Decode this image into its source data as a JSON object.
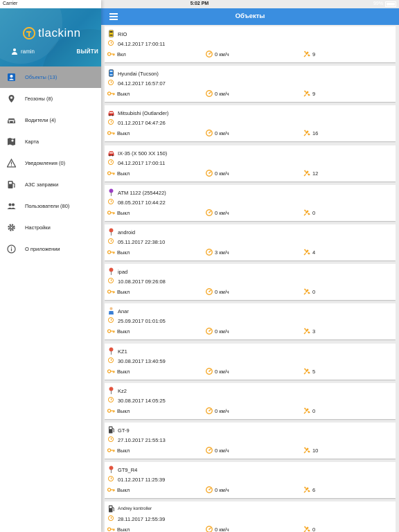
{
  "status_bar": {
    "carrier": "Carrier",
    "time": "5:02 PM",
    "battery": "99%"
  },
  "sidebar": {
    "logo": "tlackinn",
    "user": "ramin",
    "logout": "ВЫЙТИ",
    "items": [
      {
        "label": "Объекты (13)",
        "icon": "objects-icon"
      },
      {
        "label": "Геозоны (8)",
        "icon": "geofence-pin-icon"
      },
      {
        "label": "Водители (4)",
        "icon": "car-icon"
      },
      {
        "label": "Карта",
        "icon": "map-icon"
      },
      {
        "label": "Уведомления (0)",
        "icon": "warning-icon"
      },
      {
        "label": "АЗС заправки",
        "icon": "fuel-icon"
      },
      {
        "label": "Пользователи (80)",
        "icon": "users-icon"
      },
      {
        "label": "Настройки",
        "icon": "gear-icon"
      },
      {
        "label": "О приложении",
        "icon": "info-icon"
      }
    ]
  },
  "topbar": {
    "title": "Объекты"
  },
  "objects": [
    {
      "name": "RIO",
      "date": "04.12.2017 17:00:11",
      "ignition": "Вкл",
      "speed": "0 км/ч",
      "satellites": "9",
      "icon": "yellow-car-icon"
    },
    {
      "name": "Hyundai  (Tucson)",
      "date": "04.12.2017 16:57:07",
      "ignition": "Выкл",
      "speed": "0 км/ч",
      "satellites": "9",
      "icon": "blue-car-icon"
    },
    {
      "name": "Mitsubishi  (Outlander)",
      "date": "01.12.2017 04:47:26",
      "ignition": "Выкл",
      "speed": "0 км/ч",
      "satellites": "16",
      "icon": "red-car-icon"
    },
    {
      "name": "IX-35  (X 500 XX 150)",
      "date": "04.12.2017 17:00:11",
      "ignition": "Выкл",
      "speed": "0 км/ч",
      "satellites": "12",
      "icon": "red-car-icon"
    },
    {
      "name": "ATM 1122  (2554422)",
      "date": "08.05.2017 10:44:22",
      "ignition": "Выкл",
      "speed": "0 км/ч",
      "satellites": "0",
      "icon": "purple-pin-icon"
    },
    {
      "name": "android",
      "date": "05.11.2017 22:38:10",
      "ignition": "Выкл",
      "speed": "3 км/ч",
      "satellites": "4",
      "icon": "red-pin-icon"
    },
    {
      "name": "ipad",
      "date": "10.08.2017 09:26:08",
      "ignition": "Выкл",
      "speed": "0 км/ч",
      "satellites": "0",
      "icon": "red-pin-icon"
    },
    {
      "name": "Anar",
      "date": "25.09.2017 01:01:05",
      "ignition": "Выкл",
      "speed": "0 км/ч",
      "satellites": "3",
      "icon": "person-icon"
    },
    {
      "name": "KZ1",
      "date": "30.08.2017 13:40:59",
      "ignition": "Выкл",
      "speed": "0 км/ч",
      "satellites": "5",
      "icon": "red-pin-icon"
    },
    {
      "name": "Kz2",
      "date": "30.08.2017 14:05:25",
      "ignition": "Выкл",
      "speed": "0 км/ч",
      "satellites": "0",
      "icon": "red-pin-icon"
    },
    {
      "name": "GT-9",
      "date": "27.10.2017 21:55:13",
      "ignition": "Выкл",
      "speed": "0 км/ч",
      "satellites": "10",
      "icon": "fuel-pump-icon"
    },
    {
      "name": "GT9_R4",
      "date": "01.12.2017 11:25:39",
      "ignition": "Выкл",
      "speed": "0 км/ч",
      "satellites": "6",
      "icon": "red-pin-icon"
    },
    {
      "name": "Andrey kontroller",
      "date": "28.11.2017 12:55:39",
      "ignition": "Выкл",
      "speed": "0 км/ч",
      "satellites": "0",
      "icon": "fuel-pump-icon"
    }
  ],
  "colors": {
    "accent": "#3a8ee0",
    "header": "#2088b5",
    "icon_orange": "#f5a623",
    "active_item": "#a5a5a5"
  }
}
